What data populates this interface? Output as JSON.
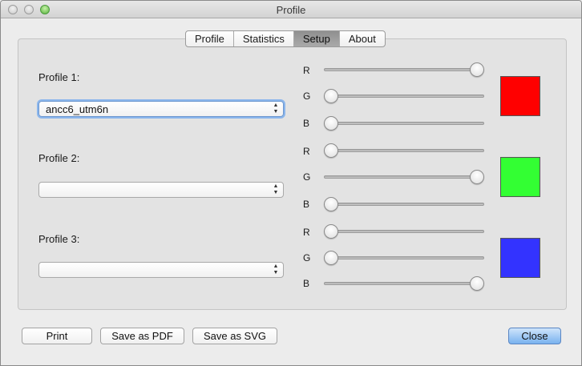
{
  "window": {
    "title": "Profile"
  },
  "tabs": [
    {
      "label": "Profile",
      "active": false
    },
    {
      "label": "Statistics",
      "active": false
    },
    {
      "label": "Setup",
      "active": true
    },
    {
      "label": "About",
      "active": false
    }
  ],
  "profiles": [
    {
      "label": "Profile 1:",
      "value": "ancc6_utm6n",
      "color": "#ff0000",
      "r": 1.0,
      "g": 0.0,
      "b": 0.0
    },
    {
      "label": "Profile 2:",
      "value": "",
      "color": "#33ff33",
      "r": 0.0,
      "g": 1.0,
      "b": 0.0
    },
    {
      "label": "Profile 3:",
      "value": "",
      "color": "#3333ff",
      "r": 0.0,
      "g": 0.0,
      "b": 1.0
    }
  ],
  "channels": {
    "r": "R",
    "g": "G",
    "b": "B"
  },
  "buttons": {
    "print": "Print",
    "save_pdf": "Save as PDF",
    "save_svg": "Save as SVG",
    "close": "Close"
  }
}
